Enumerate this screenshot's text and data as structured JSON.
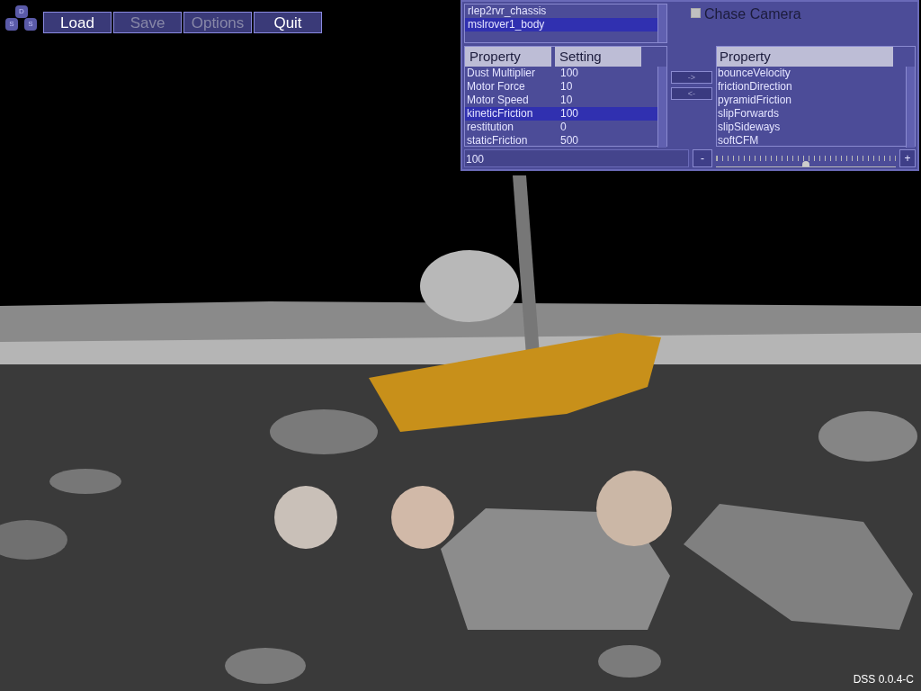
{
  "logo": {
    "letters": [
      "D",
      "S",
      "S"
    ]
  },
  "toolbar": [
    {
      "label": "Load",
      "disabled": false
    },
    {
      "label": "Save",
      "disabled": true
    },
    {
      "label": "Options",
      "disabled": true
    },
    {
      "label": "Quit",
      "disabled": false
    }
  ],
  "panel": {
    "objects": [
      {
        "label": "rlep2rvr_chassis",
        "selected": false
      },
      {
        "label": "mslrover1_body",
        "selected": true
      }
    ],
    "chase_camera": {
      "label": "Chase Camera",
      "checked": false
    },
    "settings": {
      "columns": [
        "Property",
        "Setting"
      ],
      "rows": [
        {
          "property": "Dust Multiplier",
          "setting": "100",
          "selected": false
        },
        {
          "property": "Motor Force",
          "setting": "10",
          "selected": false
        },
        {
          "property": "Motor Speed",
          "setting": "10",
          "selected": false
        },
        {
          "property": "kineticFriction",
          "setting": "100",
          "selected": true
        },
        {
          "property": "restitution",
          "setting": "0",
          "selected": false
        },
        {
          "property": "staticFriction",
          "setting": "500",
          "selected": false
        }
      ]
    },
    "move_buttons": [
      "->",
      "<-"
    ],
    "available": {
      "column": "Property",
      "rows": [
        "bounceVelocity",
        "frictionDirection",
        "pyramidFriction",
        "slipForwards",
        "slipSideways",
        "softCFM"
      ]
    },
    "value_field": "100",
    "minus": "-",
    "plus": "+",
    "slider": {
      "level": 0.5
    }
  },
  "version": "DSS 0.0.4-C"
}
